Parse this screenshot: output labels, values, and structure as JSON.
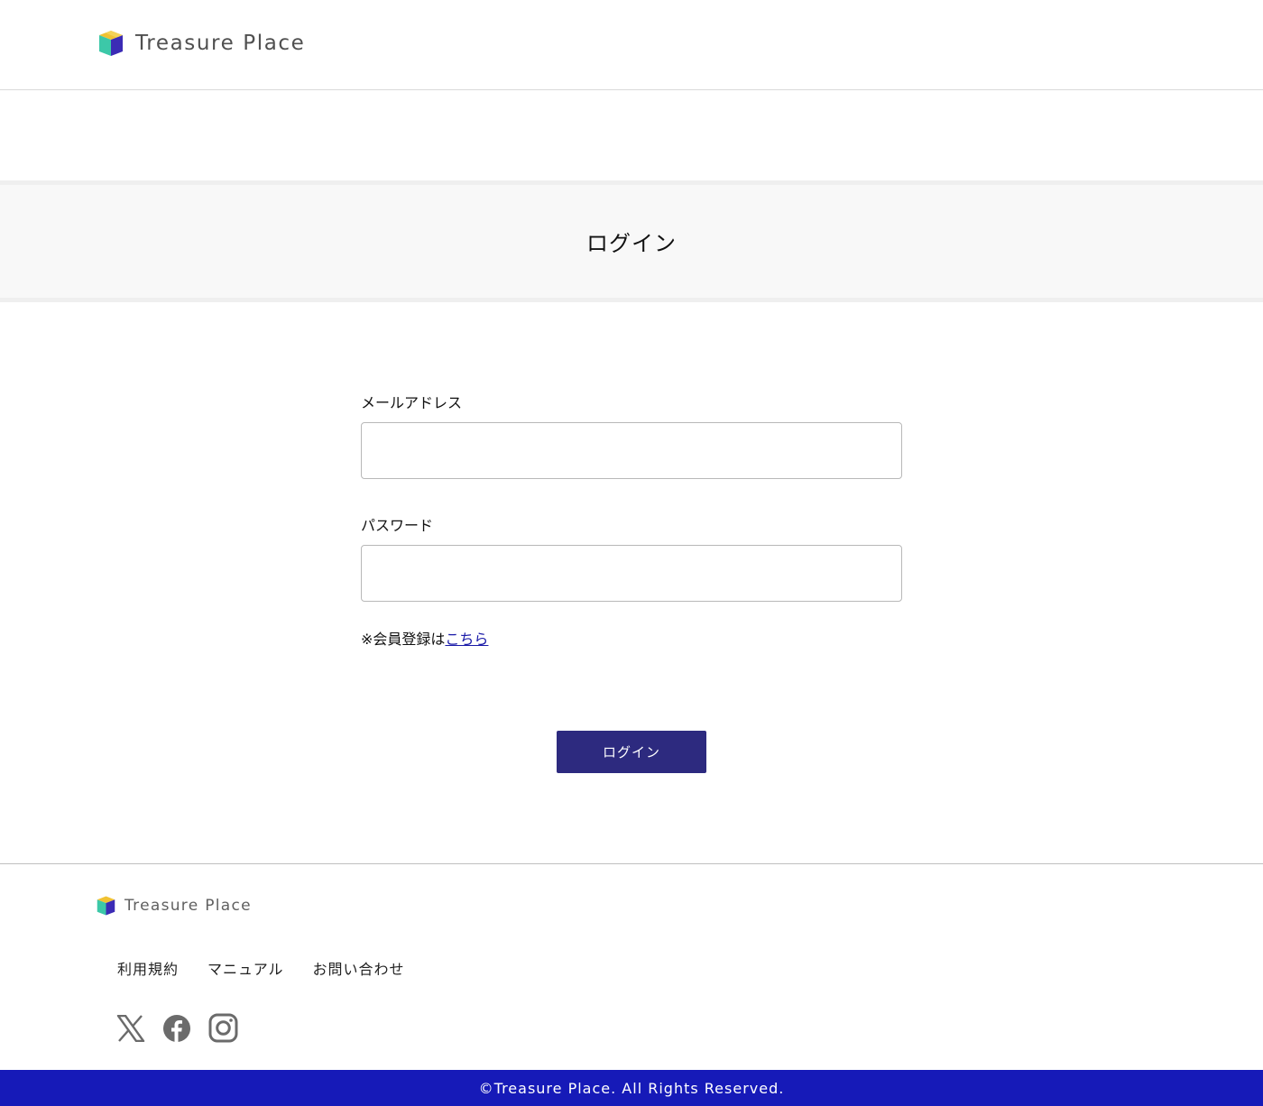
{
  "header": {
    "brand_name": "Treasure Place",
    "logo_icon": "cube-logo-icon"
  },
  "page": {
    "title": "ログイン"
  },
  "form": {
    "email_label": "メールアドレス",
    "email_value": "",
    "password_label": "パスワード",
    "password_value": "",
    "register_note": "※会員登録は",
    "register_link": "こちら",
    "submit_label": "ログイン"
  },
  "footer": {
    "brand_name": "Treasure Place",
    "nav": [
      "利用規約",
      "マニュアル",
      "お問い合わせ"
    ],
    "social": [
      "x-icon",
      "facebook-icon",
      "instagram-icon"
    ],
    "copyright": "©Treasure Place. All Rights Reserved."
  },
  "colors": {
    "button_bg": "#2d2a7f",
    "copyright_bg": "#161ab8",
    "link": "#1a1aa8"
  }
}
